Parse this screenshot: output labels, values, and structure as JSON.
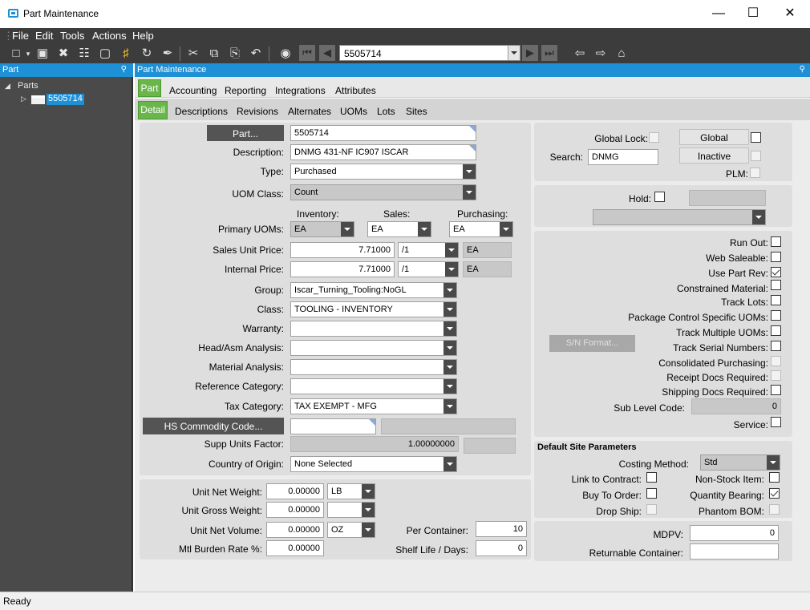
{
  "window": {
    "title": "Part Maintenance"
  },
  "menu": [
    "File",
    "Edit",
    "Tools",
    "Actions",
    "Help"
  ],
  "toolbar": {
    "part_number": "5505714"
  },
  "tree": {
    "header": "Part",
    "root": "Parts",
    "item": "5505714"
  },
  "main": {
    "header": "Part Maintenance",
    "tabs": [
      "Part",
      "Accounting",
      "Reporting",
      "Integrations",
      "Attributes"
    ],
    "subtabs": [
      "Detail",
      "Descriptions",
      "Revisions",
      "Alternates",
      "UOMs",
      "Lots",
      "Sites"
    ]
  },
  "form": {
    "part_btn": "Part...",
    "part_value": "5505714",
    "description_label": "Description:",
    "description_value": "DNMG 431-NF IC907 ISCAR",
    "type_label": "Type:",
    "type_value": "Purchased",
    "uom_class_label": "UOM Class:",
    "uom_class_value": "Count",
    "inventory_label": "Inventory:",
    "sales_label": "Sales:",
    "purchasing_label": "Purchasing:",
    "primary_uoms_label": "Primary UOMs:",
    "inventory_uom": "EA",
    "sales_uom": "EA",
    "purchasing_uom": "EA",
    "sales_unit_price_label": "Sales Unit Price:",
    "sales_unit_price": "7.71000",
    "sales_price_per": "/1",
    "sales_price_uom": "EA",
    "internal_price_label": "Internal Price:",
    "internal_price": "7.71000",
    "internal_price_per": "/1",
    "internal_price_uom": "EA",
    "group_label": "Group:",
    "group_value": "Iscar_Turning_Tooling:NoGL",
    "class_label": "Class:",
    "class_value": "TOOLING - INVENTORY",
    "warranty_label": "Warranty:",
    "head_asm_label": "Head/Asm Analysis:",
    "material_analysis_label": "Material Analysis:",
    "reference_category_label": "Reference Category:",
    "tax_category_label": "Tax Category:",
    "tax_category_value": "TAX EXEMPT - MFG",
    "hs_commodity_btn": "HS Commodity Code...",
    "supp_units_factor_label": "Supp Units Factor:",
    "supp_units_factor": "1.00000000",
    "country_of_origin_label": "Country of Origin:",
    "country_of_origin_value": "None Selected",
    "unit_net_weight_label": "Unit Net Weight:",
    "unit_net_weight": "0.00000",
    "unit_net_weight_uom": "LB",
    "unit_gross_weight_label": "Unit Gross Weight:",
    "unit_gross_weight": "0.00000",
    "unit_net_volume_label": "Unit Net Volume:",
    "unit_net_volume": "0.00000",
    "unit_net_volume_uom": "OZ",
    "mtl_burden_rate_label": "Mtl Burden Rate %:",
    "mtl_burden_rate": "0.00000",
    "per_container_label": "Per Container:",
    "per_container": "10",
    "shelf_life_label": "Shelf Life / Days:",
    "shelf_life": "0"
  },
  "right": {
    "global_lock_label": "Global Lock:",
    "global_btn": "Global",
    "search_label": "Search:",
    "search_value": "DNMG",
    "inactive_btn": "Inactive",
    "plm_label": "PLM:",
    "hold_label": "Hold:",
    "sn_format_btn": "S/N Format...",
    "flags": [
      {
        "label": "Run Out:",
        "checked": false
      },
      {
        "label": "Web Saleable:",
        "checked": false
      },
      {
        "label": "Use Part Rev:",
        "checked": true
      },
      {
        "label": "Constrained Material:",
        "checked": false
      },
      {
        "label": "Track Lots:",
        "checked": false
      },
      {
        "label": "Package Control Specific UOMs:",
        "checked": false
      },
      {
        "label": "Track Multiple UOMs:",
        "checked": false
      },
      {
        "label": "Track Serial Numbers:",
        "checked": false
      },
      {
        "label": "Consolidated Purchasing:",
        "checked": false
      },
      {
        "label": "Receipt Docs Required:",
        "checked": false
      },
      {
        "label": "Shipping Docs Required:",
        "checked": false
      }
    ],
    "sub_level_code_label": "Sub Level Code:",
    "sub_level_code": "0",
    "service_label": "Service:",
    "default_site_params_title": "Default Site Parameters",
    "costing_method_label": "Costing Method:",
    "costing_method_value": "Std",
    "link_to_contract_label": "Link to Contract:",
    "non_stock_item_label": "Non-Stock Item:",
    "buy_to_order_label": "Buy To Order:",
    "quantity_bearing_label": "Quantity Bearing:",
    "drop_ship_label": "Drop Ship:",
    "phantom_bom_label": "Phantom BOM:",
    "mdpv_label": "MDPV:",
    "mdpv_value": "0",
    "returnable_container_label": "Returnable Container:"
  },
  "status": {
    "text": "Ready"
  }
}
